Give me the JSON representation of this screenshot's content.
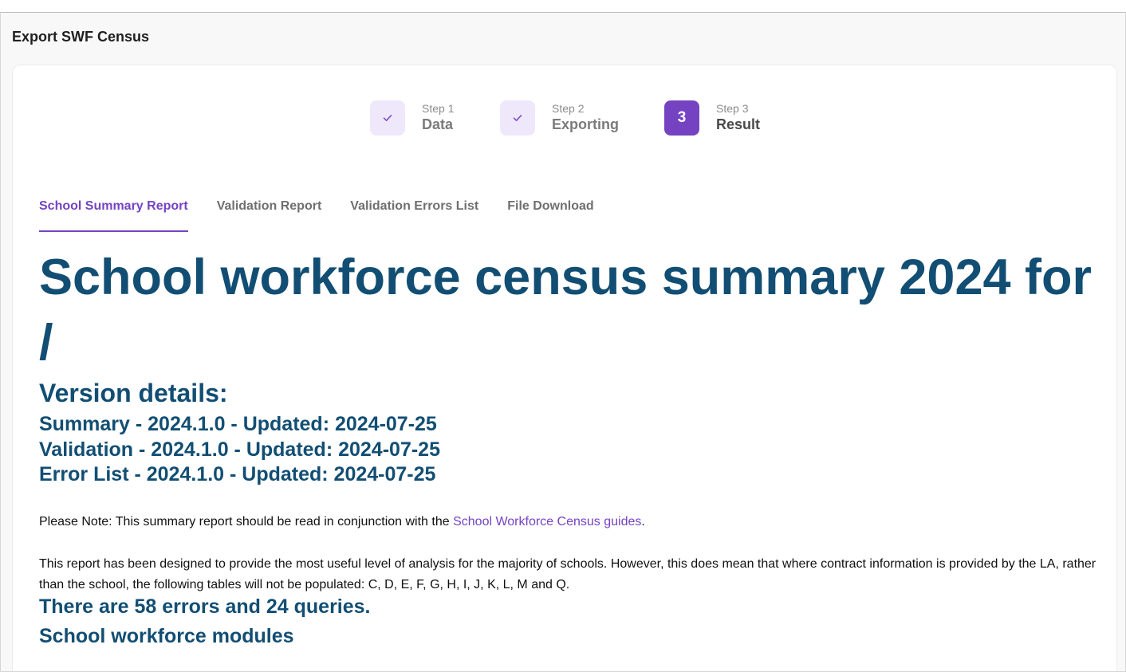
{
  "window": {
    "title": "Export SWF Census"
  },
  "stepper": {
    "steps": [
      {
        "label": "Step 1",
        "name": "Data",
        "status": "complete",
        "icon": "check-icon"
      },
      {
        "label": "Step 2",
        "name": "Exporting",
        "status": "complete",
        "icon": "check-icon"
      },
      {
        "label": "Step 3",
        "name": "Result",
        "status": "current",
        "number": "3"
      }
    ]
  },
  "tabs": [
    {
      "label": "School Summary Report",
      "active": true
    },
    {
      "label": "Validation Report",
      "active": false
    },
    {
      "label": "Validation Errors List",
      "active": false
    },
    {
      "label": "File Download",
      "active": false
    }
  ],
  "report": {
    "title": "School workforce census summary 2024 for /",
    "version_heading": "Version details:",
    "versions": [
      "Summary - 2024.1.0 - Updated: 2024-07-25",
      "Validation - 2024.1.0 - Updated: 2024-07-25",
      "Error List - 2024.1.0 - Updated: 2024-07-25"
    ],
    "note_prefix": "Please Note: This summary report should be read in conjunction with the ",
    "note_link": "School Workforce Census guides",
    "note_suffix": ".",
    "intro": "This report has been designed to provide the most useful level of analysis for the majority of schools. However, this does mean that where contract information is provided by the LA, rather than the school, the following tables will not be populated: C, D, E, F, G, H, I, J, K, L, M and Q.",
    "errors_summary": "There are 58 errors and 24 queries.",
    "modules_heading": "School workforce modules"
  },
  "colors": {
    "accent": "#7543c2",
    "heading": "#124e73",
    "step_bg": "#efe8fb"
  }
}
